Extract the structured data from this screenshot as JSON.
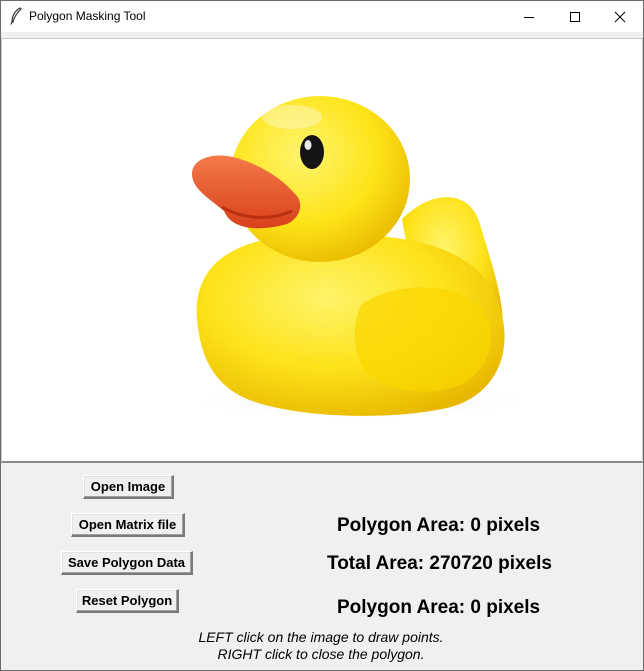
{
  "window": {
    "title": "Polygon Masking Tool",
    "icon": "feather-icon",
    "controls": [
      "minimize-icon",
      "maximize-icon",
      "close-icon"
    ]
  },
  "canvas": {
    "image_subject": "yellow-rubber-duck-image"
  },
  "buttons": {
    "open_image": "Open Image",
    "open_matrix": "Open Matrix file",
    "save_polygon": "Save Polygon Data",
    "reset_polygon": "Reset Polygon"
  },
  "stats": {
    "polygon_area_1": "Polygon Area: 0 pixels",
    "total_area": "Total Area: 270720 pixels",
    "polygon_area_2": "Polygon Area: 0 pixels"
  },
  "instructions": {
    "line1": "LEFT click on the image to draw points.",
    "line2": "RIGHT click to close the polygon."
  }
}
